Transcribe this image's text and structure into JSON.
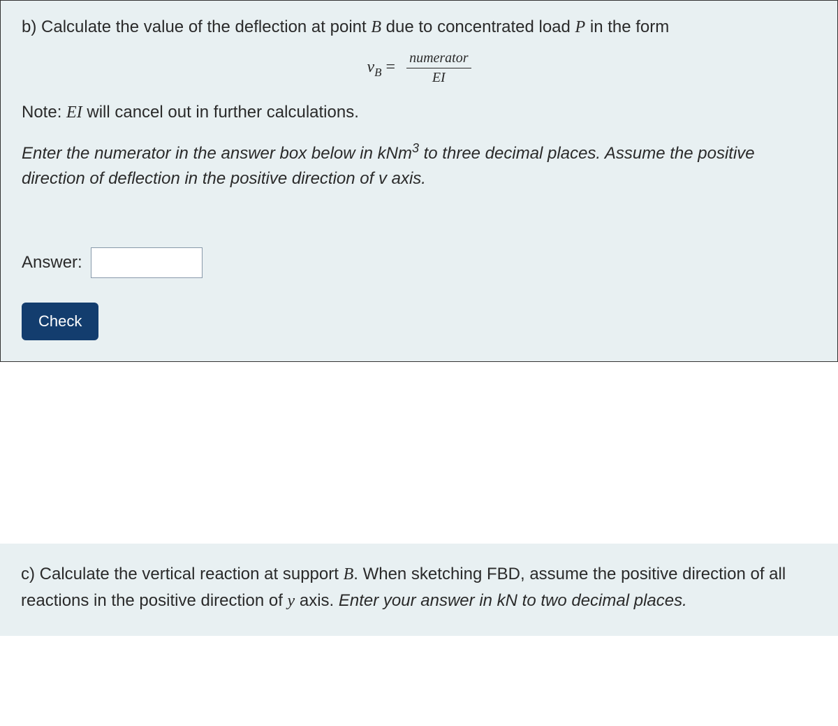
{
  "section_b": {
    "part_label": "b)",
    "question_prefix": "Calculate the value of the deflection at point ",
    "point_name": "B",
    "question_mid": " due to concentrated load ",
    "load_name": "P",
    "question_suffix": " in the form",
    "equation": {
      "lhs_var": "v",
      "lhs_sub": "B",
      "equals": " = ",
      "numerator": "numerator",
      "denominator": "EI"
    },
    "note_prefix": "Note: ",
    "note_var": "EI",
    "note_suffix": " will cancel out in further calculations.",
    "instruction_prefix": "Enter the numerator in the answer box below in kNm",
    "instruction_exp": "3",
    "instruction_suffix": " to three decimal places. Assume the positive direction of deflection in the positive direction of v axis.",
    "answer_label": "Answer:",
    "check_button": "Check"
  },
  "section_c": {
    "part_label": "c)",
    "text_prefix": " Calculate the vertical reaction at support ",
    "support_name": "B",
    "text_mid1": ". When sketching FBD, assume the positive direction of all reactions in the positive direction of ",
    "axis_name": "y",
    "text_mid2": " axis. ",
    "italic_text": "Enter your answer in kN to two decimal places."
  }
}
